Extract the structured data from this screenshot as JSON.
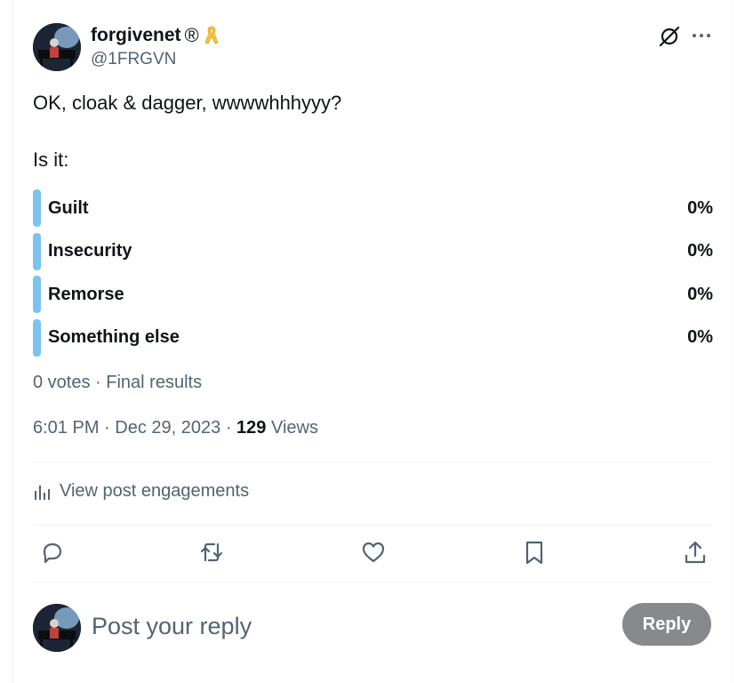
{
  "author": {
    "display_name": "forgivenet",
    "registered_mark": "®",
    "handle": "@1FRGVN",
    "badge_icon": "yellow-ribbon-icon",
    "badge_color": "#f5c542"
  },
  "post": {
    "line1": "OK, cloak & dagger, wwwwhhhyyy?",
    "line2": "Is it:"
  },
  "poll": {
    "options": [
      {
        "label": "Guilt",
        "percent": "0%"
      },
      {
        "label": "Insecurity",
        "percent": "0%"
      },
      {
        "label": "Remorse",
        "percent": "0%"
      },
      {
        "label": "Something else",
        "percent": "0%"
      }
    ],
    "bar_color": "#7cc3f1",
    "summary": "0 votes · Final results"
  },
  "meta": {
    "time": "6:01 PM",
    "date": "Dec 29, 2023",
    "views_count": "129",
    "views_label": "Views"
  },
  "engagements_label": "View post engagements",
  "actions": {
    "icons": [
      "reply-icon",
      "repost-icon",
      "like-icon",
      "bookmark-icon",
      "share-icon"
    ]
  },
  "reply": {
    "placeholder": "Post your reply",
    "button_label": "Reply",
    "button_color": "#87898c"
  },
  "colors": {
    "text_primary": "#0f1419",
    "text_secondary": "#536471",
    "divider": "#eff3f4"
  }
}
